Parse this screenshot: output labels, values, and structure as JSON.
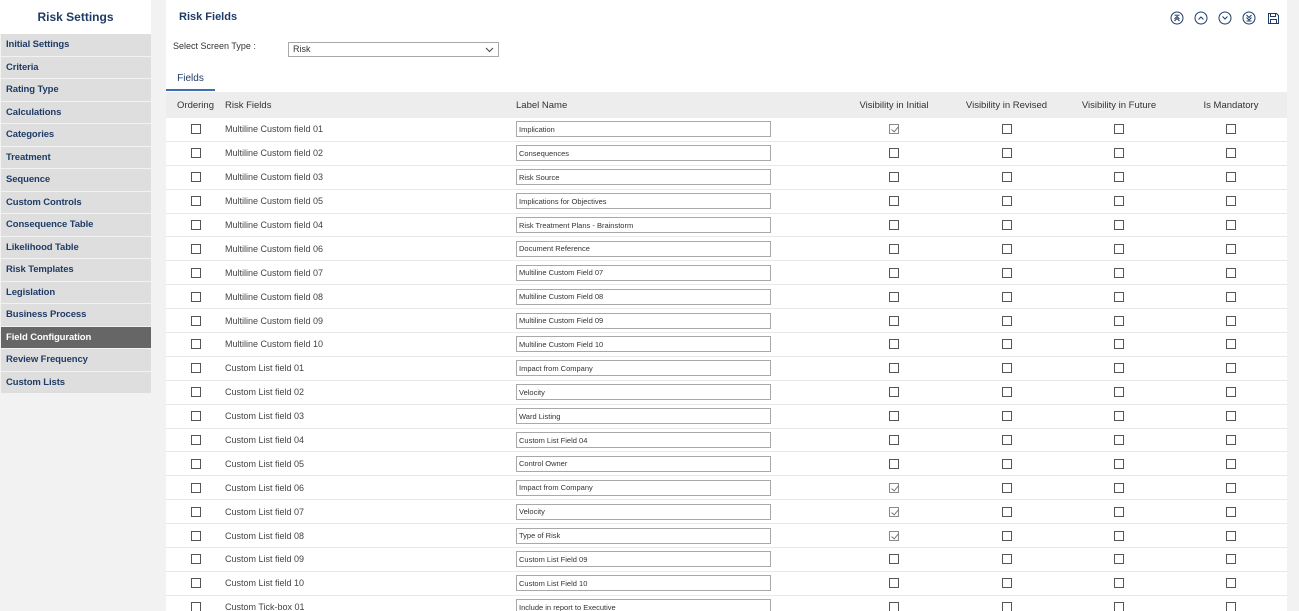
{
  "sidebar": {
    "title": "Risk Settings",
    "items": [
      {
        "label": "Initial Settings",
        "active": false
      },
      {
        "label": "Criteria",
        "active": false
      },
      {
        "label": "Rating Type",
        "active": false
      },
      {
        "label": "Calculations",
        "active": false
      },
      {
        "label": "Categories",
        "active": false
      },
      {
        "label": "Treatment",
        "active": false
      },
      {
        "label": "Sequence",
        "active": false
      },
      {
        "label": "Custom Controls",
        "active": false
      },
      {
        "label": "Consequence Table",
        "active": false
      },
      {
        "label": "Likelihood Table",
        "active": false
      },
      {
        "label": "Risk Templates",
        "active": false
      },
      {
        "label": "Legislation",
        "active": false
      },
      {
        "label": "Business Process",
        "active": false
      },
      {
        "label": "Field Configuration",
        "active": true
      },
      {
        "label": "Review Frequency",
        "active": false
      },
      {
        "label": "Custom Lists",
        "active": false
      }
    ]
  },
  "main": {
    "title": "Risk Fields",
    "toolbar": {
      "icons": [
        "move-top-icon",
        "move-up-icon",
        "move-down-icon",
        "move-bottom-icon",
        "save-icon"
      ]
    },
    "screen_type": {
      "label": "Select Screen Type :",
      "value": "Risk"
    },
    "tab": "Fields"
  },
  "table": {
    "headers": {
      "ordering": "Ordering",
      "risk_fields": "Risk Fields",
      "label_name": "Label Name",
      "vis_initial": "Visibility in Initial",
      "vis_revised": "Visibility in Revised",
      "vis_future": "Visibility in Future",
      "mandatory": "Is Mandatory"
    },
    "rows": [
      {
        "field": "Multiline Custom field 01",
        "label": "Implication",
        "initial": true,
        "revised": false,
        "future": false,
        "mandatory": false
      },
      {
        "field": "Multiline Custom field 02",
        "label": "Consequences",
        "initial": false,
        "revised": false,
        "future": false,
        "mandatory": false
      },
      {
        "field": "Multiline Custom field 03",
        "label": "Risk Source",
        "initial": false,
        "revised": false,
        "future": false,
        "mandatory": false
      },
      {
        "field": "Multiline Custom field 05",
        "label": "Implications for Objectives",
        "initial": false,
        "revised": false,
        "future": false,
        "mandatory": false
      },
      {
        "field": "Multiline Custom field 04",
        "label": "Risk Treatment Plans - Brainstorm",
        "initial": false,
        "revised": false,
        "future": false,
        "mandatory": false
      },
      {
        "field": "Multiline Custom field 06",
        "label": "Document Reference",
        "initial": false,
        "revised": false,
        "future": false,
        "mandatory": false
      },
      {
        "field": "Multiline Custom field 07",
        "label": "Multiline Custom Field 07",
        "initial": false,
        "revised": false,
        "future": false,
        "mandatory": false
      },
      {
        "field": "Multiline Custom field 08",
        "label": "Multiline Custom Field 08",
        "initial": false,
        "revised": false,
        "future": false,
        "mandatory": false
      },
      {
        "field": "Multiline Custom field 09",
        "label": "Multiline Custom Field 09",
        "initial": false,
        "revised": false,
        "future": false,
        "mandatory": false
      },
      {
        "field": "Multiline Custom field 10",
        "label": "Multiline Custom Field 10",
        "initial": false,
        "revised": false,
        "future": false,
        "mandatory": false
      },
      {
        "field": "Custom List field 01",
        "label": "Impact from Company",
        "initial": false,
        "revised": false,
        "future": false,
        "mandatory": false
      },
      {
        "field": "Custom List field 02",
        "label": "Velocity",
        "initial": false,
        "revised": false,
        "future": false,
        "mandatory": false
      },
      {
        "field": "Custom List field 03",
        "label": "Ward Listing",
        "initial": false,
        "revised": false,
        "future": false,
        "mandatory": false
      },
      {
        "field": "Custom List field 04",
        "label": "Custom List Field 04",
        "initial": false,
        "revised": false,
        "future": false,
        "mandatory": false
      },
      {
        "field": "Custom List field 05",
        "label": "Control Owner",
        "initial": false,
        "revised": false,
        "future": false,
        "mandatory": false
      },
      {
        "field": "Custom List field 06",
        "label": "Impact from Company",
        "initial": true,
        "revised": false,
        "future": false,
        "mandatory": false
      },
      {
        "field": "Custom List field 07",
        "label": "Velocity",
        "initial": true,
        "revised": false,
        "future": false,
        "mandatory": false
      },
      {
        "field": "Custom List field 08",
        "label": "Type of Risk",
        "initial": true,
        "revised": false,
        "future": false,
        "mandatory": false
      },
      {
        "field": "Custom List field 09",
        "label": "Custom List Field 09",
        "initial": false,
        "revised": false,
        "future": false,
        "mandatory": false
      },
      {
        "field": "Custom List field 10",
        "label": "Custom List Field 10",
        "initial": false,
        "revised": false,
        "future": false,
        "mandatory": false
      },
      {
        "field": "Custom Tick-box 01",
        "label": "Include in report to Executive",
        "initial": false,
        "revised": false,
        "future": false,
        "mandatory": false
      }
    ]
  }
}
